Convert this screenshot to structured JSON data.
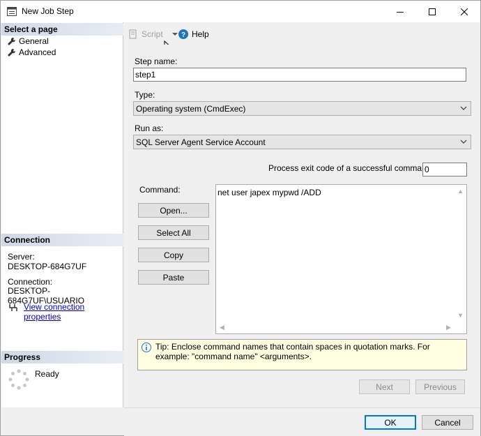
{
  "window": {
    "title": "New Job Step"
  },
  "sidebar": {
    "select_page_header": "Select a page",
    "pages": [
      {
        "label": "General",
        "icon": "wrench-icon"
      },
      {
        "label": "Advanced",
        "icon": "wrench-icon"
      }
    ],
    "connection_header": "Connection",
    "server_label": "Server:",
    "server_value": "DESKTOP-684G7UF",
    "connection_label": "Connection:",
    "connection_value": "DESKTOP-684G7UF\\USUARIO",
    "view_connection_link": "View connection properties",
    "progress_header": "Progress",
    "progress_status": "Ready"
  },
  "toolbar": {
    "script_label": "Script",
    "help_label": "Help"
  },
  "form": {
    "step_name_label": "Step name:",
    "step_name_value": "step1",
    "type_label": "Type:",
    "type_value": "Operating system (CmdExec)",
    "run_as_label": "Run as:",
    "run_as_value": "SQL Server Agent Service Account",
    "exit_code_label": "Process exit code of a successful command:",
    "exit_code_value": "0",
    "command_label": "Command:",
    "command_value": "net user japex mypwd /ADD",
    "buttons": {
      "open": "Open...",
      "select_all": "Select All",
      "copy": "Copy",
      "paste": "Paste"
    },
    "tip_text": "Tip: Enclose command names that contain spaces in quotation marks. For example: \"command name\" <arguments>.",
    "next_label": "Next",
    "previous_label": "Previous"
  },
  "footer": {
    "ok_label": "OK",
    "cancel_label": "Cancel"
  },
  "colors": {
    "link": "#0000cc",
    "tip_background": "#ffffe1",
    "section_header": "#cfd9e6",
    "ok_border": "#0078d7"
  }
}
